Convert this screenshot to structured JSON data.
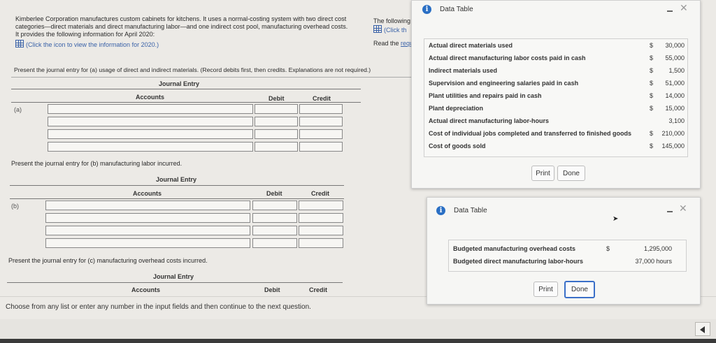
{
  "problem": {
    "intro_line1": "Kimberlee Corporation manufactures custom cabinets for kitchens. It uses a normal-costing system with two direct cost",
    "intro_line2": "categories—direct materials and direct manufacturing labor—and one indirect cost pool, manufacturing overhead costs.",
    "intro_line3": "It provides the following information for April 2020:",
    "info_link": "(Click the icon to view the information for 2020.)",
    "side_line1": "The following",
    "side_line2": "(Click th",
    "side_line3": "Read the ",
    "side_line3_link": "requ"
  },
  "part_a": {
    "prompt": "Present the journal entry for (a) usage of direct and indirect materials. (Record debits first, then credits. Explanations are not required.)",
    "title": "Journal Entry",
    "col_accounts": "Accounts",
    "col_debit": "Debit",
    "col_credit": "Credit",
    "label": "(a)"
  },
  "part_b": {
    "prompt": "Present the journal entry for (b) manufacturing labor incurred.",
    "title": "Journal Entry",
    "col_accounts": "Accounts",
    "col_debit": "Debit",
    "col_credit": "Credit",
    "label": "(b)"
  },
  "part_c": {
    "prompt": "Present the journal entry for (c) manufacturing overhead costs incurred.",
    "title": "Journal Entry",
    "col_accounts": "Accounts",
    "col_debit": "Debit",
    "col_credit": "Credit"
  },
  "footer_hint": "Choose from any list or enter any number in the input fields and then continue to the next question.",
  "dialog1": {
    "title": "Data Table",
    "rows": [
      {
        "name": "Actual direct materials used",
        "cur": "$",
        "amt": "30,000"
      },
      {
        "name": "Actual direct manufacturing labor costs paid in cash",
        "cur": "$",
        "amt": "55,000"
      },
      {
        "name": "Indirect materials used",
        "cur": "$",
        "amt": "1,500"
      },
      {
        "name": "Supervision and engineering salaries paid in cash",
        "cur": "$",
        "amt": "51,000"
      },
      {
        "name": "Plant utilities and repairs paid in cash",
        "cur": "$",
        "amt": "14,000"
      },
      {
        "name": "Plant depreciation",
        "cur": "$",
        "amt": "15,000"
      },
      {
        "name": "Actual direct manufacturing labor-hours",
        "cur": "",
        "amt": "3,100"
      },
      {
        "name": "Cost of individual jobs completed and transferred to finished goods",
        "cur": "$",
        "amt": "210,000"
      },
      {
        "name": "Cost of goods sold",
        "cur": "$",
        "amt": "145,000"
      }
    ],
    "print": "Print",
    "done": "Done"
  },
  "dialog2": {
    "title": "Data Table",
    "rows": [
      {
        "name": "Budgeted manufacturing overhead costs",
        "cur": "$",
        "amt": "1,295,000"
      },
      {
        "name": "Budgeted direct manufacturing labor-hours",
        "cur": "",
        "amt": "37,000 hours"
      }
    ],
    "print": "Print",
    "done": "Done"
  },
  "colors": {
    "accent": "#2a6fc4",
    "link": "#3a62a8",
    "background": "#eceae6"
  }
}
